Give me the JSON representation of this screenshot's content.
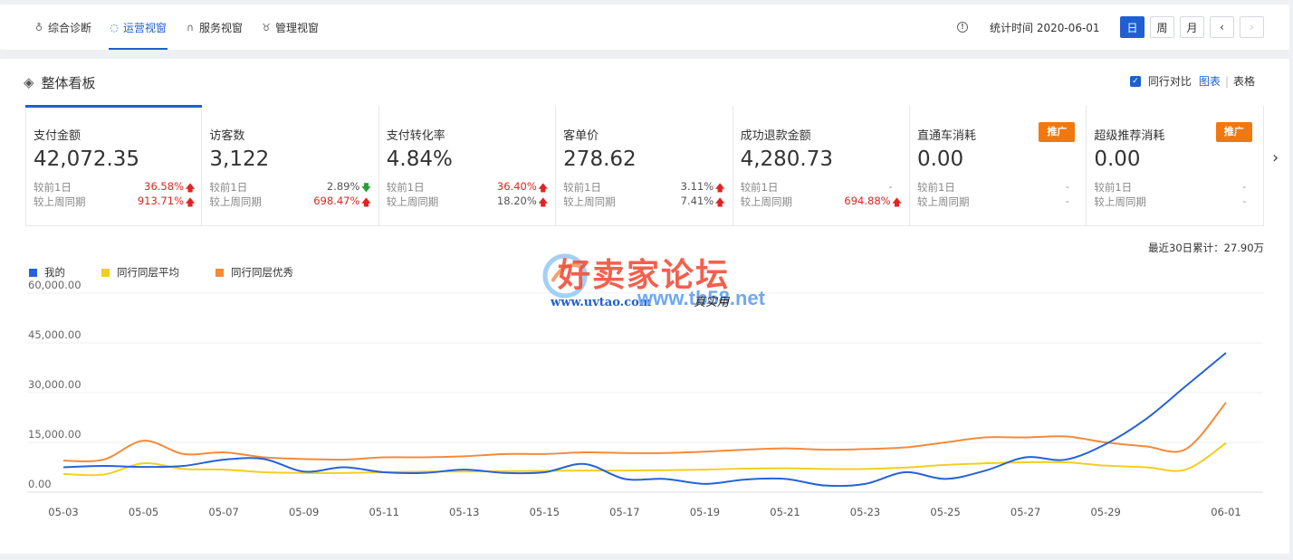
{
  "nav": {
    "tabs": [
      {
        "label": "综合诊断",
        "icon": "bulb-icon",
        "active": false
      },
      {
        "label": "运营视窗",
        "icon": "shield-icon",
        "active": true
      },
      {
        "label": "服务视窗",
        "icon": "headset-icon",
        "active": false
      },
      {
        "label": "管理视窗",
        "icon": "medal-icon",
        "active": false
      }
    ],
    "stat_time": "统计时间 2020-06-01",
    "periods": [
      "日",
      "周",
      "月"
    ],
    "prev": "‹",
    "next": "›"
  },
  "board": {
    "title": "整体看板",
    "compare_label": "同行对比",
    "view_chart": "图表",
    "view_table": "表格"
  },
  "metrics": [
    {
      "name": "支付金额",
      "value": "42,072.35",
      "r1_label": "较前1日",
      "r1_value": "36.58%",
      "r1_dir": "up",
      "r2_label": "较上周同期",
      "r2_value": "913.71%",
      "r2_dir": "up"
    },
    {
      "name": "访客数",
      "value": "3,122",
      "r1_label": "较前1日",
      "r1_value": "2.89%",
      "r1_dir": "down",
      "r2_label": "较上周同期",
      "r2_value": "698.47%",
      "r2_dir": "up"
    },
    {
      "name": "支付转化率",
      "value": "4.84%",
      "r1_label": "较前1日",
      "r1_value": "36.40%",
      "r1_dir": "up",
      "r2_label": "较上周同期",
      "r2_value": "18.20%",
      "r2_dir": "up-gray"
    },
    {
      "name": "客单价",
      "value": "278.62",
      "r1_label": "较前1日",
      "r1_value": "3.11%",
      "r1_dir": "up-gray",
      "r2_label": "较上周同期",
      "r2_value": "7.41%",
      "r2_dir": "up-gray"
    },
    {
      "name": "成功退款金额",
      "value": "4,280.73",
      "r1_label": "较前1日",
      "r1_value": "-",
      "r1_dir": "none",
      "r2_label": "较上周同期",
      "r2_value": "694.88%",
      "r2_dir": "up"
    },
    {
      "name": "直通车消耗",
      "value": "0.00",
      "promo": "推广",
      "r1_label": "较前1日",
      "r1_value": "-",
      "r1_dir": "none",
      "r2_label": "较上周同期",
      "r2_value": "-",
      "r2_dir": "none"
    },
    {
      "name": "超级推荐消耗",
      "value": "0.00",
      "promo": "推广",
      "r1_label": "较前1日",
      "r1_value": "-",
      "r1_dir": "none",
      "r2_label": "较上周同期",
      "r2_value": "-",
      "r2_dir": "none"
    }
  ],
  "next_metrics": "›",
  "cumulative": "最近30日累计：27.90万",
  "watermark": {
    "title": "好卖家论坛",
    "url1": "www.uvtao.com",
    "url2": "www.tb58.net",
    "sign": "真实用"
  },
  "colors": {
    "accent": "#1f5fd1",
    "up": "#e02424",
    "down": "#27a038",
    "promo": "#f07810"
  },
  "chart_data": {
    "type": "line",
    "x": [
      "05-03",
      "05-04",
      "05-05",
      "05-06",
      "05-07",
      "05-08",
      "05-09",
      "05-10",
      "05-11",
      "05-12",
      "05-13",
      "05-14",
      "05-15",
      "05-16",
      "05-17",
      "05-18",
      "05-19",
      "05-20",
      "05-21",
      "05-22",
      "05-23",
      "05-24",
      "05-25",
      "05-26",
      "05-27",
      "05-28",
      "05-29",
      "05-30",
      "05-31",
      "06-01"
    ],
    "xticks": [
      "05-03",
      "05-05",
      "05-07",
      "05-09",
      "05-11",
      "05-13",
      "05-15",
      "05-17",
      "05-19",
      "05-21",
      "05-23",
      "05-25",
      "05-27",
      "05-29",
      "06-01"
    ],
    "yticks": [
      "60,000.00",
      "45,000.00",
      "30,000.00",
      "15,000.00",
      "0.00"
    ],
    "ylim": [
      0,
      60000
    ],
    "series": [
      {
        "name": "我的",
        "color": "#2563d6",
        "values": [
          7500,
          7900,
          7600,
          7900,
          9800,
          10000,
          6200,
          7500,
          6000,
          5800,
          6800,
          5800,
          6000,
          8500,
          4000,
          4000,
          2500,
          3800,
          4000,
          2000,
          2500,
          6000,
          4000,
          6500,
          10500,
          9800,
          14500,
          22000,
          32000,
          42000
        ]
      },
      {
        "name": "同行同层平均",
        "color": "#f2cf1e",
        "values": [
          5500,
          5300,
          8700,
          7000,
          6800,
          6000,
          5800,
          5800,
          6000,
          6200,
          6200,
          6300,
          6400,
          6500,
          6500,
          6600,
          6800,
          7100,
          7200,
          7000,
          7000,
          7400,
          8200,
          8700,
          9000,
          9000,
          8000,
          7500,
          6800,
          14800
        ]
      },
      {
        "name": "同行同层优秀",
        "color": "#f58a3a",
        "values": [
          9500,
          9800,
          15500,
          11500,
          12000,
          10500,
          10000,
          9800,
          10500,
          10500,
          10800,
          11500,
          11500,
          12000,
          11800,
          11800,
          12200,
          12800,
          13200,
          12800,
          13000,
          13500,
          15000,
          16500,
          16500,
          16800,
          15000,
          13800,
          13000,
          27000
        ]
      }
    ]
  }
}
